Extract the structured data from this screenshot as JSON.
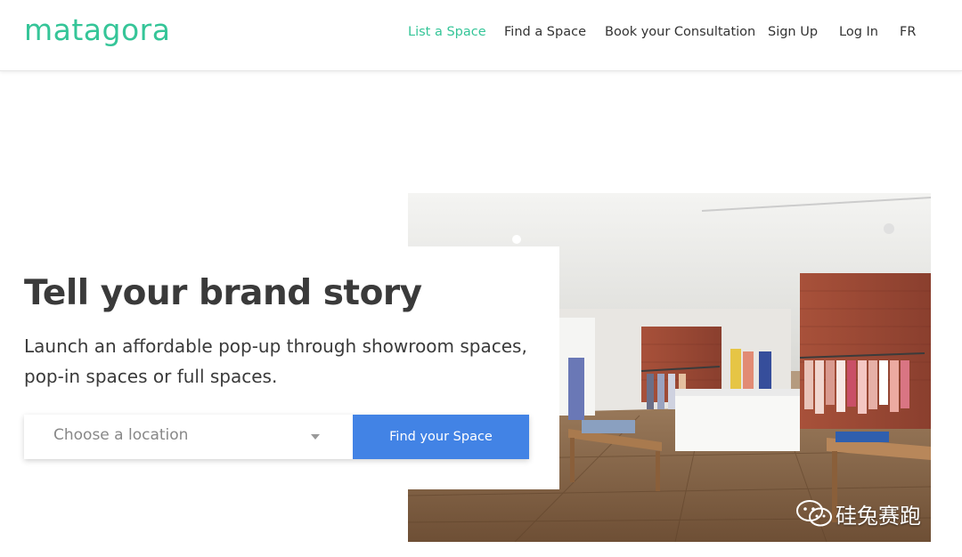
{
  "brand": {
    "logo": "matagora",
    "accent_color": "#35c598"
  },
  "nav": {
    "items": [
      {
        "label": "List a Space",
        "active": true
      },
      {
        "label": "Find a Space",
        "active": false
      },
      {
        "label": "Book your Consultation",
        "active": false
      },
      {
        "label": "Sign Up",
        "active": false
      },
      {
        "label": "Log In",
        "active": false
      },
      {
        "label": "FR",
        "active": false
      }
    ]
  },
  "hero": {
    "title": "Tell your brand story",
    "subtitle": "Launch an affordable pop-up through showroom spaces, pop-in spaces or full spaces.",
    "image_icon": "boutique-interior-photo"
  },
  "search": {
    "location_placeholder": "Choose a location",
    "dropdown_icon": "chevron-down-icon",
    "button_label": "Find your Space",
    "button_color": "#4283e5"
  },
  "watermark": {
    "text": "硅兔赛跑",
    "icon": "wechat-icon"
  }
}
